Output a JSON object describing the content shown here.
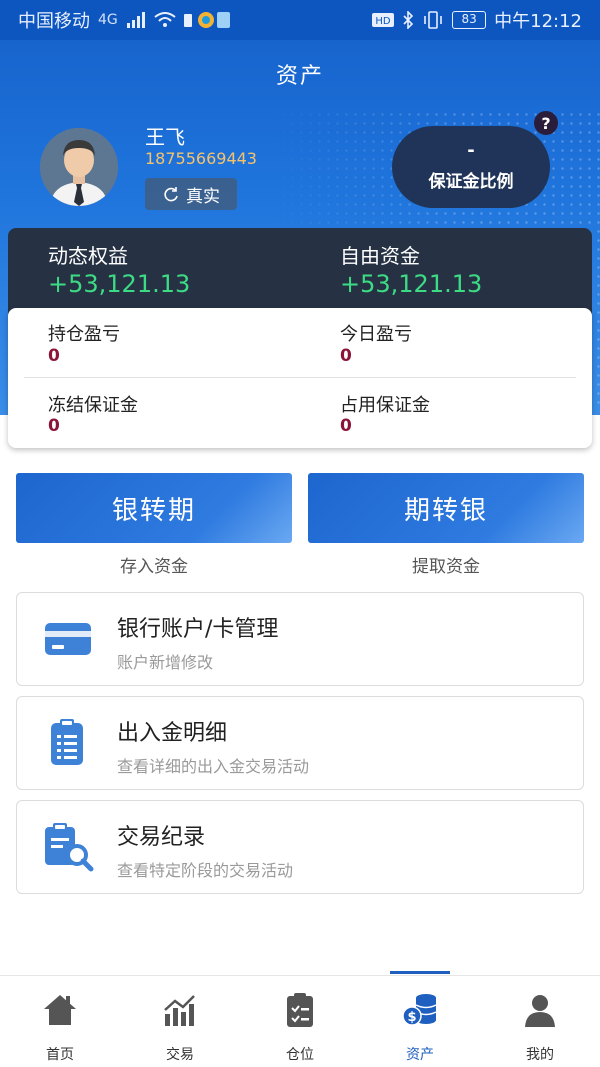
{
  "status_bar": {
    "carrier": "中国移动",
    "network": "4G",
    "battery": "83",
    "time": "中午12:12"
  },
  "header": {
    "title": "资产"
  },
  "user": {
    "name": "王飞",
    "phone": "18755669443",
    "verify_label": "真实"
  },
  "margin_ratio": {
    "value": "-",
    "label": "保证金比例",
    "help": "?"
  },
  "equity": {
    "dynamic_label": "动态权益",
    "dynamic_value": "+53,121.13",
    "free_label": "自由资金",
    "free_value": "+53,121.13"
  },
  "summary": {
    "position_pnl_label": "持仓盈亏",
    "position_pnl_value": "0",
    "today_pnl_label": "今日盈亏",
    "today_pnl_value": "0",
    "frozen_margin_label": "冻结保证金",
    "frozen_margin_value": "0",
    "used_margin_label": "占用保证金",
    "used_margin_value": "0"
  },
  "actions": {
    "bank_to_futures": "银转期",
    "bank_to_futures_sub": "存入资金",
    "futures_to_bank": "期转银",
    "futures_to_bank_sub": "提取资金"
  },
  "menu": [
    {
      "title": "银行账户/卡管理",
      "sub": "账户新增修改",
      "icon": "bank-card-icon"
    },
    {
      "title": "出入金明细",
      "sub": "查看详细的出入金交易活动",
      "icon": "clipboard-list-icon"
    },
    {
      "title": "交易纪录",
      "sub": "查看特定阶段的交易活动",
      "icon": "record-search-icon"
    }
  ],
  "tabs": [
    {
      "label": "首页",
      "icon": "home-icon"
    },
    {
      "label": "交易",
      "icon": "chart-icon"
    },
    {
      "label": "仓位",
      "icon": "checklist-icon"
    },
    {
      "label": "资产",
      "icon": "coins-icon"
    },
    {
      "label": "我的",
      "icon": "user-icon"
    }
  ],
  "colors": {
    "primary": "#1f5fbf",
    "gain_green": "#3ddc84",
    "value_red": "#8b1538",
    "phone_gold": "#f6c36b"
  }
}
